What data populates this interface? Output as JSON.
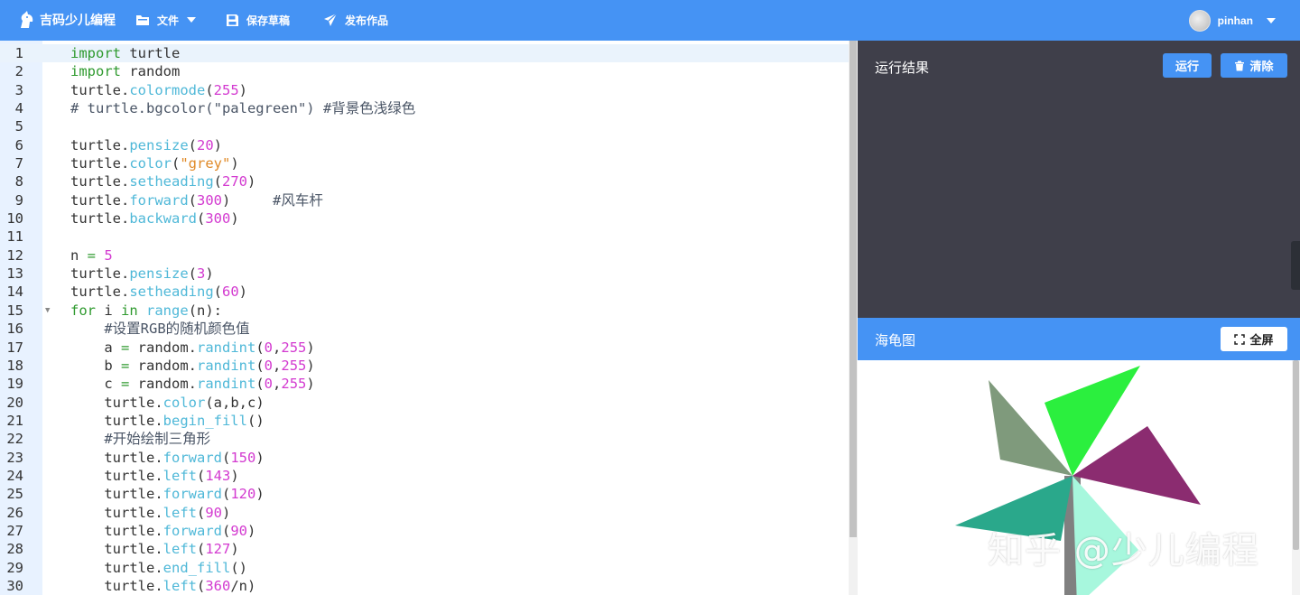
{
  "header": {
    "brand": "吉码少儿编程",
    "menu": [
      {
        "label": "文件",
        "icon": "folder-icon",
        "has_dropdown": true
      },
      {
        "label": "保存草稿",
        "icon": "save-icon"
      },
      {
        "label": "发布作品",
        "icon": "send-icon"
      }
    ],
    "user": {
      "name": "pinhan"
    },
    "colors": {
      "bar": "#4593f4"
    }
  },
  "editor": {
    "lines": [
      {
        "n": "1",
        "text": "import turtle"
      },
      {
        "n": "2",
        "text": "import random"
      },
      {
        "n": "3",
        "text": "turtle.colormode(255)"
      },
      {
        "n": "4",
        "text": "# turtle.bgcolor(\"palegreen\") #背景色浅绿色"
      },
      {
        "n": "5",
        "text": ""
      },
      {
        "n": "6",
        "text": "turtle.pensize(20)"
      },
      {
        "n": "7",
        "text": "turtle.color(\"grey\")"
      },
      {
        "n": "8",
        "text": "turtle.setheading(270)"
      },
      {
        "n": "9",
        "text": "turtle.forward(300)     #风车杆"
      },
      {
        "n": "10",
        "text": "turtle.backward(300)"
      },
      {
        "n": "11",
        "text": ""
      },
      {
        "n": "12",
        "text": "n = 5"
      },
      {
        "n": "13",
        "text": "turtle.pensize(3)"
      },
      {
        "n": "14",
        "text": "turtle.setheading(60)"
      },
      {
        "n": "15",
        "text": "for i in range(n):"
      },
      {
        "n": "16",
        "text": "    #设置RGB的随机颜色值"
      },
      {
        "n": "17",
        "text": "    a = random.randint(0,255)"
      },
      {
        "n": "18",
        "text": "    b = random.randint(0,255)"
      },
      {
        "n": "19",
        "text": "    c = random.randint(0,255)"
      },
      {
        "n": "20",
        "text": "    turtle.color(a,b,c)"
      },
      {
        "n": "21",
        "text": "    turtle.begin_fill()"
      },
      {
        "n": "22",
        "text": "    #开始绘制三角形"
      },
      {
        "n": "23",
        "text": "    turtle.forward(150)"
      },
      {
        "n": "24",
        "text": "    turtle.left(143)"
      },
      {
        "n": "25",
        "text": "    turtle.forward(120)"
      },
      {
        "n": "26",
        "text": "    turtle.left(90)"
      },
      {
        "n": "27",
        "text": "    turtle.forward(90)"
      },
      {
        "n": "28",
        "text": "    turtle.left(127)"
      },
      {
        "n": "29",
        "text": "    turtle.end_fill()"
      },
      {
        "n": "30",
        "text": "    turtle.left(360/n)"
      }
    ]
  },
  "result_panel": {
    "title": "运行结果",
    "run_label": "运行",
    "clear_label": "清除"
  },
  "turtle_panel": {
    "title": "海龟图",
    "fullscreen_label": "全屏",
    "watermark": "知乎 @少儿编程",
    "blade_colors": [
      "#7f9a7c",
      "#2bef3e",
      "#8b2c70",
      "#a7f7dd",
      "#2aa88b"
    ],
    "pole_color": "#808080"
  }
}
